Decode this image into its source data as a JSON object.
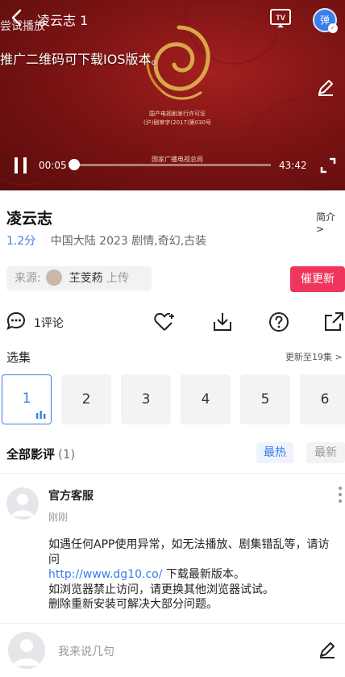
{
  "player": {
    "trial_text": "尝试播放",
    "video_title": "凌云志 1",
    "promo_text": "推广二维码可下载IOS版本。",
    "license_line1": "国产电视剧发行许可证",
    "license_line2": "(沪)剧审字(2017)第030号",
    "broadcaster": "国家广播电视总局",
    "avatar_char": "弹",
    "time_current": "00:05",
    "time_total": "43:42",
    "progress": 0.002
  },
  "info": {
    "title": "凌云志",
    "intro_link": "简介 >",
    "score": "1.2分",
    "details": "中国大陆  2023  剧情,奇幻,古装",
    "source_label": "来源:",
    "uploader": "芏芰菞",
    "upload_suffix": "上传",
    "update_button": "催更新"
  },
  "actions": {
    "comment_count": "1评论"
  },
  "episodes": {
    "label": "选集",
    "update_info": "更新至19集 >",
    "items": [
      "1",
      "2",
      "3",
      "4",
      "5",
      "6"
    ]
  },
  "reviews": {
    "title": "全部影评",
    "count": "(1)",
    "sort_hot": "最热",
    "sort_new": "最新"
  },
  "comment": {
    "name": "官方客服",
    "time": "刚刚",
    "line1": "如遇任何APP使用异常，如无法播放、剧集错乱等，请访问",
    "link": "http://www.dg10.co/",
    "line2": " 下载最新版本。",
    "line3": "如浏览器禁止访问，请更换其他浏览器试试。",
    "line4": "删除重新安装可解决大部分问题。"
  },
  "bottom": {
    "compose_placeholder": "我来说几句"
  },
  "colors": {
    "accent_blue": "#3a7ee8",
    "update_red": "#f0365d",
    "player_red": "#7e1414"
  }
}
